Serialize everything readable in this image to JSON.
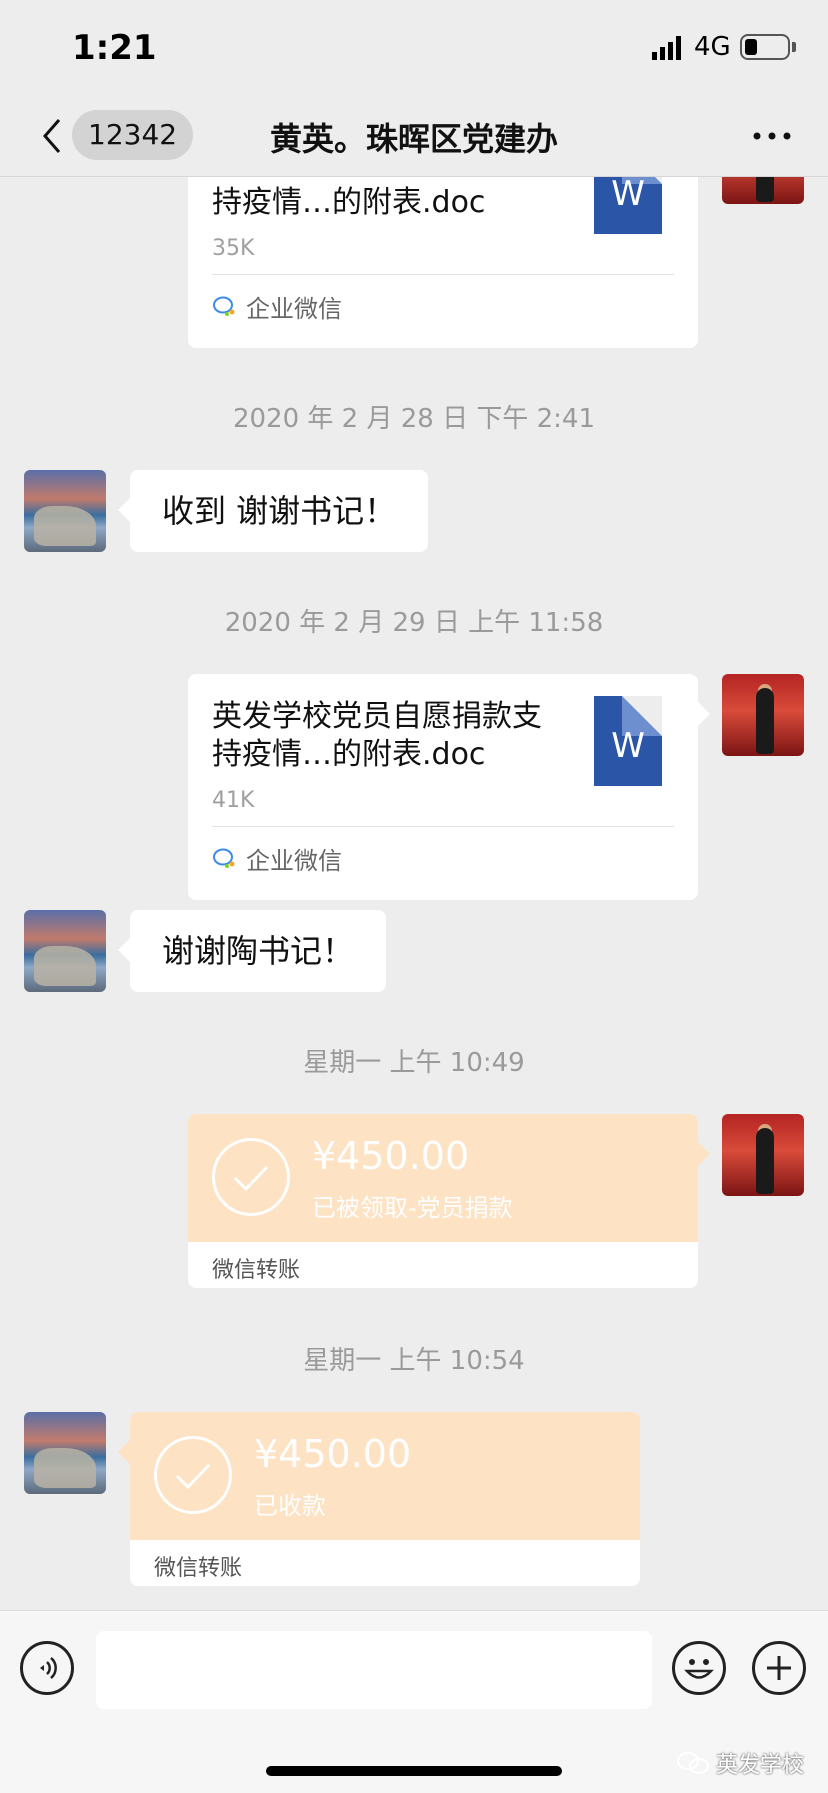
{
  "status": {
    "time": "1:21",
    "network": "4G"
  },
  "nav": {
    "badge": "12342",
    "title": "黄英。珠晖区党建办"
  },
  "messages": {
    "file1": {
      "name": "英发学校党员自愿捐款支持疫情…的附表.doc",
      "size": "35K",
      "source": "企业微信"
    },
    "time1": "2020 年 2 月 28 日 下午 2:41",
    "text1": "收到  谢谢书记！",
    "time2": "2020 年 2 月 29 日 上午 11:58",
    "file2": {
      "name": "英发学校党员自愿捐款支持疫情…的附表.doc",
      "size": "41K",
      "source": "企业微信"
    },
    "text2": "谢谢陶书记！",
    "time3": "星期一 上午 10:49",
    "transfer1": {
      "amount": "¥450.00",
      "status": "已被领取-党员捐款",
      "label": "微信转账"
    },
    "time4": "星期一 上午 10:54",
    "transfer2": {
      "amount": "¥450.00",
      "status": "已收款",
      "label": "微信转账"
    }
  },
  "input": {
    "value": ""
  },
  "watermark": "英发学校",
  "colors": {
    "background": "#ededed",
    "transfer": "#fde2c4",
    "word": "#2b56a8"
  }
}
